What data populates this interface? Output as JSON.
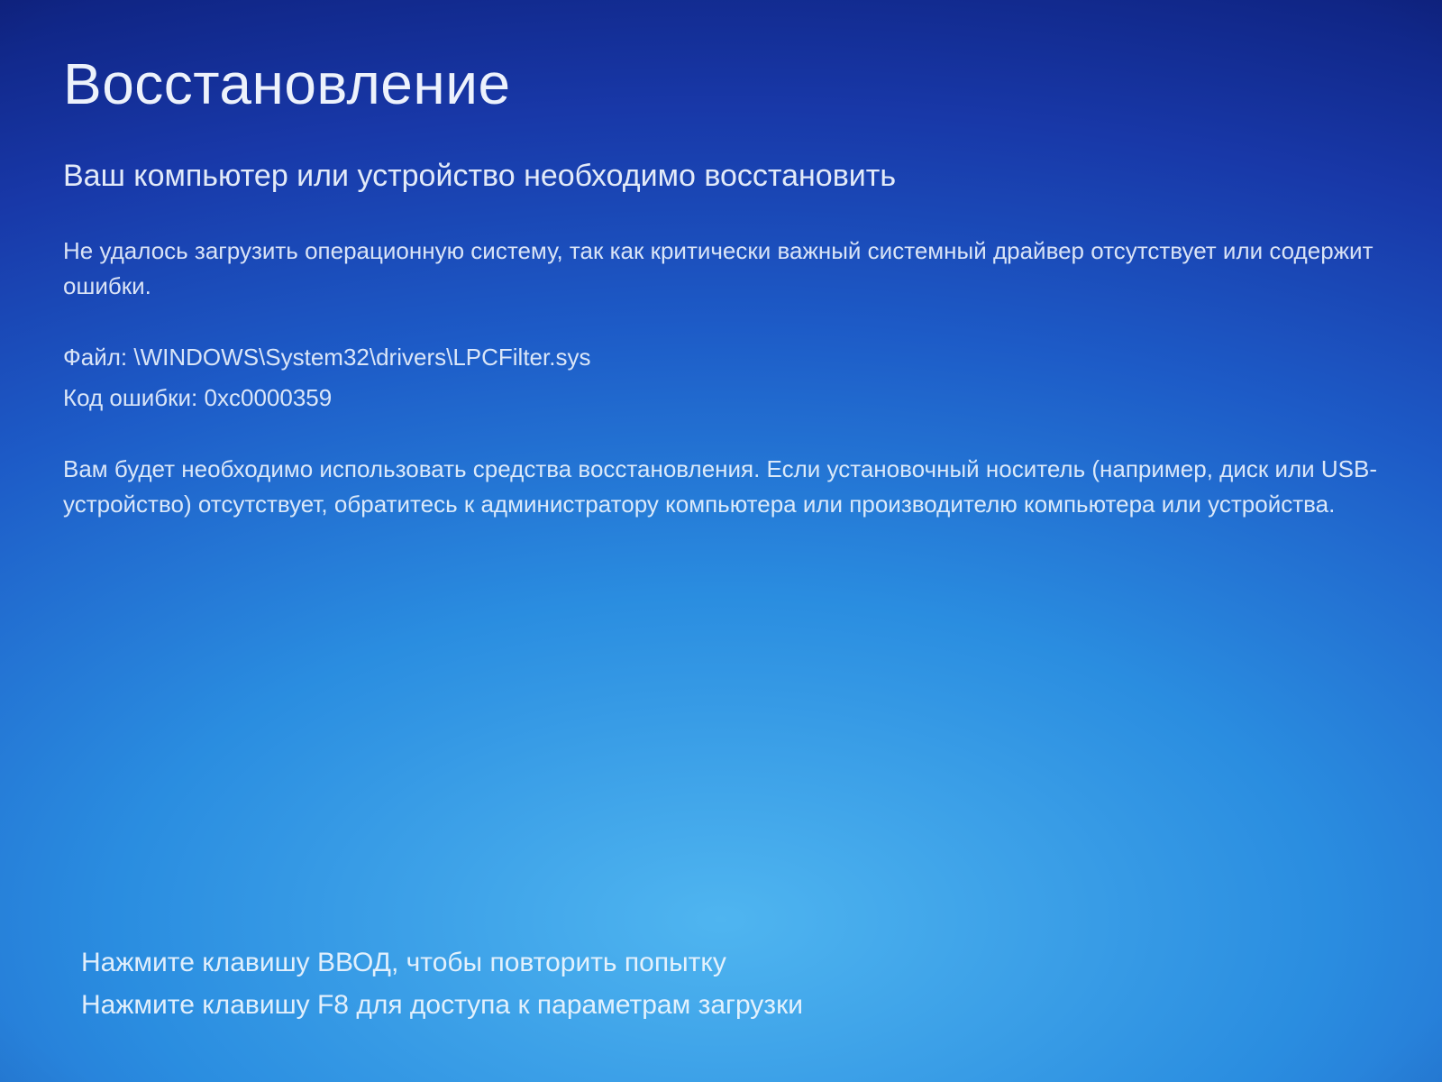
{
  "title": "Восстановление",
  "subtitle": "Ваш компьютер или устройство необходимо восстановить",
  "reason": "Не удалось загрузить операционную систему, так как критически важный системный драйвер отсутствует или содержит ошибки.",
  "file_label": "Файл:",
  "file_path": "\\WINDOWS\\System32\\drivers\\LPCFilter.sys",
  "error_code_label": "Код ошибки:",
  "error_code": "0xc0000359",
  "instructions": "Вам будет необходимо использовать средства восстановления. Если установочный носитель (например, диск или USB-устройство) отсутствует, обратитесь к администратору компьютера или производителю компьютера или устройства.",
  "footer": {
    "retry": "Нажмите клавишу ВВОД, чтобы повторить попытку",
    "f8": "Нажмите клавишу F8 для доступа к параметрам загрузки"
  }
}
